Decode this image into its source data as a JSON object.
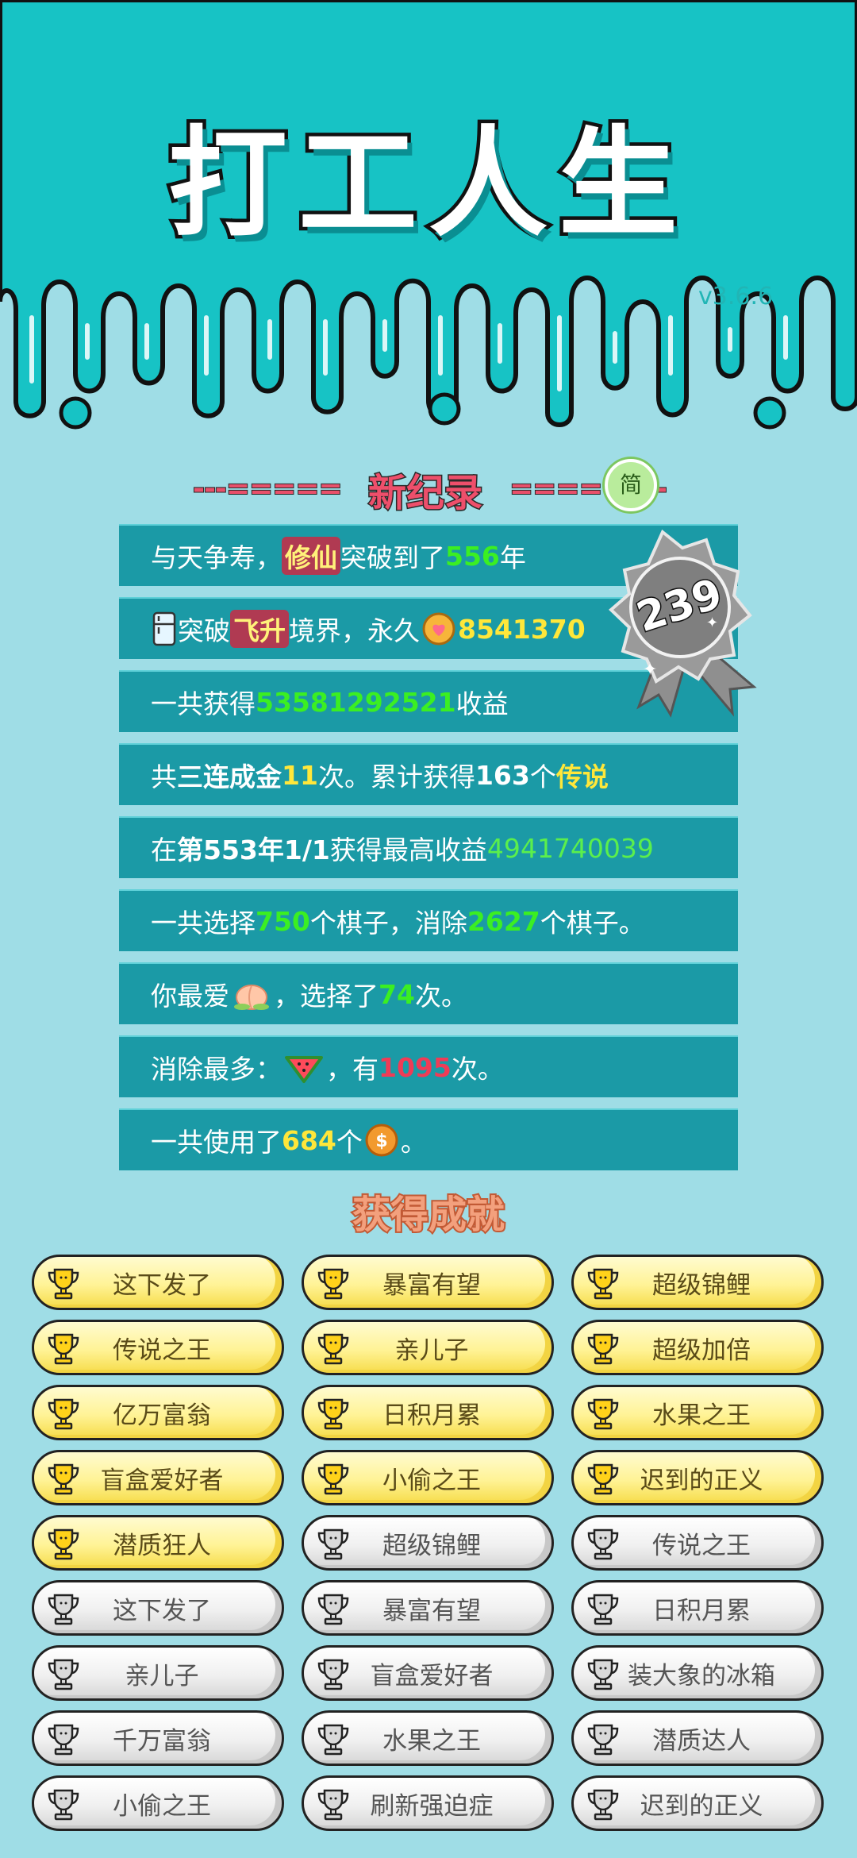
{
  "app": {
    "title": "打工人生",
    "version": "v3.6.6"
  },
  "record": {
    "dash_left": "---=====",
    "title": "新纪录",
    "dash_right": "=====",
    "dash_tail": "-",
    "simple_badge": "简",
    "medal_number": "239"
  },
  "stats": [
    {
      "parts": [
        {
          "t": "与天争寿，"
        },
        {
          "t": "修仙",
          "c": "pink-hl"
        },
        {
          "t": "突破到了"
        },
        {
          "t": "556",
          "c": "g"
        },
        {
          "t": "年"
        }
      ]
    },
    {
      "parts": [
        {
          "icon": "fridge-icon"
        },
        {
          "t": "突破"
        },
        {
          "t": "飞升",
          "c": "pink-hl"
        },
        {
          "t": "境界，永久"
        },
        {
          "icon": "heart-coin-icon"
        },
        {
          "t": "8541370",
          "c": "y"
        }
      ]
    },
    {
      "parts": [
        {
          "t": "一共获得"
        },
        {
          "t": "53581292521",
          "c": "g"
        },
        {
          "t": "收益"
        }
      ]
    },
    {
      "parts": [
        {
          "t": "共"
        },
        {
          "t": "三连成金",
          "c": "w"
        },
        {
          "t": "11",
          "c": "y"
        },
        {
          "t": "次。累计获得"
        },
        {
          "t": "163",
          "c": "w"
        },
        {
          "t": "个"
        },
        {
          "t": "传说",
          "c": "y"
        }
      ]
    },
    {
      "parts": [
        {
          "t": "在 "
        },
        {
          "t": "第553年1/1",
          "c": "w"
        },
        {
          "t": " 获得最高收益"
        },
        {
          "t": "4941740039",
          "c": "yg"
        }
      ]
    },
    {
      "parts": [
        {
          "t": "一共选择"
        },
        {
          "t": "750",
          "c": "g"
        },
        {
          "t": "个棋子，消除"
        },
        {
          "t": "2627",
          "c": "g"
        },
        {
          "t": "个棋子。"
        }
      ]
    },
    {
      "parts": [
        {
          "t": "你最爱"
        },
        {
          "icon": "peach-icon"
        },
        {
          "t": "，选择了"
        },
        {
          "t": "74",
          "c": "g"
        },
        {
          "t": "次。"
        }
      ]
    },
    {
      "parts": [
        {
          "t": "消除最多："
        },
        {
          "icon": "watermelon-icon"
        },
        {
          "t": "，有"
        },
        {
          "t": "1095",
          "c": "r"
        },
        {
          "t": "次。"
        }
      ]
    },
    {
      "parts": [
        {
          "t": "一共使用了"
        },
        {
          "t": "684",
          "c": "y"
        },
        {
          "t": "个"
        },
        {
          "icon": "coin-icon"
        },
        {
          "t": "。"
        }
      ]
    }
  ],
  "achievements_title": "获得成就",
  "achievements": [
    {
      "label": "这下发了",
      "tier": "gold"
    },
    {
      "label": "暴富有望",
      "tier": "gold"
    },
    {
      "label": "超级锦鲤",
      "tier": "gold"
    },
    {
      "label": "传说之王",
      "tier": "gold"
    },
    {
      "label": "亲儿子",
      "tier": "gold"
    },
    {
      "label": "超级加倍",
      "tier": "gold"
    },
    {
      "label": "亿万富翁",
      "tier": "gold"
    },
    {
      "label": "日积月累",
      "tier": "gold"
    },
    {
      "label": "水果之王",
      "tier": "gold"
    },
    {
      "label": "盲盒爱好者",
      "tier": "gold"
    },
    {
      "label": "小偷之王",
      "tier": "gold"
    },
    {
      "label": "迟到的正义",
      "tier": "gold"
    },
    {
      "label": "潜质狂人",
      "tier": "gold"
    },
    {
      "label": "超级锦鲤",
      "tier": "silver"
    },
    {
      "label": "传说之王",
      "tier": "silver"
    },
    {
      "label": "这下发了",
      "tier": "silver"
    },
    {
      "label": "暴富有望",
      "tier": "silver"
    },
    {
      "label": "日积月累",
      "tier": "silver"
    },
    {
      "label": "亲儿子",
      "tier": "silver"
    },
    {
      "label": "盲盒爱好者",
      "tier": "silver"
    },
    {
      "label": "装大象的冰箱",
      "tier": "silver"
    },
    {
      "label": "千万富翁",
      "tier": "silver"
    },
    {
      "label": "水果之王",
      "tier": "silver"
    },
    {
      "label": "潜质达人",
      "tier": "silver"
    },
    {
      "label": "小偷之王",
      "tier": "silver"
    },
    {
      "label": "刷新强迫症",
      "tier": "silver"
    },
    {
      "label": "迟到的正义",
      "tier": "silver"
    }
  ],
  "colors": {
    "teal": "#17c3c5",
    "bg": "#9fdde6",
    "row": "#1b9aa6",
    "gold": "#fff396",
    "silver": "#efefef"
  }
}
